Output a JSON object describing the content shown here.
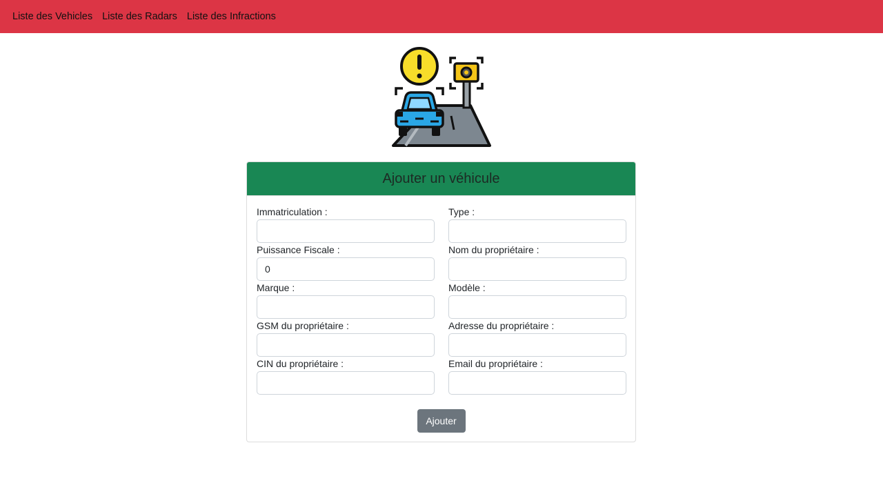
{
  "navbar": {
    "links": [
      {
        "label": "Liste des Vehicles"
      },
      {
        "label": "Liste des Radars"
      },
      {
        "label": "Liste des Infractions"
      }
    ]
  },
  "illustration": {
    "icon": "speed-radar-car-warning-icon"
  },
  "form": {
    "title": "Ajouter un véhicule",
    "fields": [
      {
        "label": "Immatriculation :",
        "value": ""
      },
      {
        "label": "Type :",
        "value": ""
      },
      {
        "label": "Puissance Fiscale :",
        "value": "0"
      },
      {
        "label": "Nom du propriétaire :",
        "value": ""
      },
      {
        "label": "Marque :",
        "value": ""
      },
      {
        "label": "Modèle :",
        "value": ""
      },
      {
        "label": "GSM du propriétaire :",
        "value": ""
      },
      {
        "label": "Adresse du propriétaire :",
        "value": ""
      },
      {
        "label": "CIN du propriétaire :",
        "value": ""
      },
      {
        "label": "Email du propriétaire :",
        "value": ""
      }
    ],
    "submit_label": "Ajouter"
  },
  "colors": {
    "navbar": "#dc3545",
    "card_header": "#198754",
    "submit_button": "#6c757d"
  }
}
